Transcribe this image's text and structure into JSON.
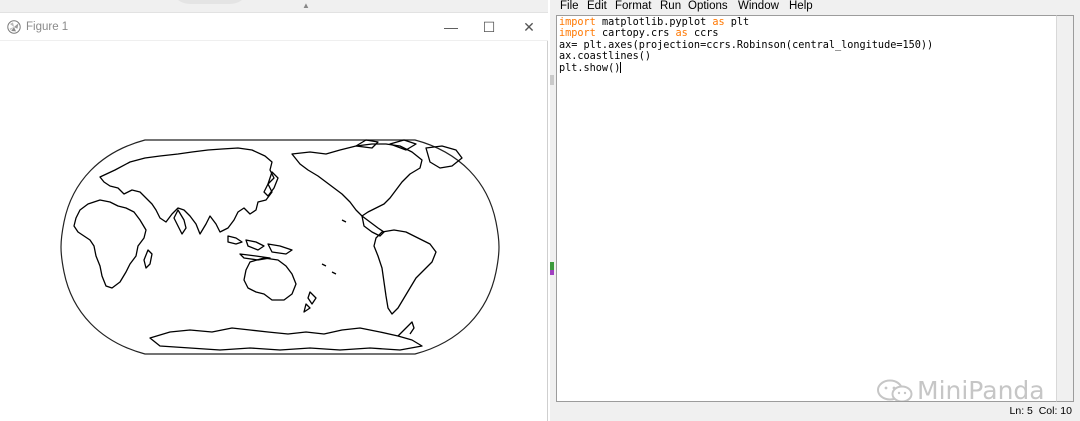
{
  "figure_window": {
    "title": "Figure 1",
    "controls": {
      "minimize": "—",
      "maximize": "☐",
      "close": "✕"
    }
  },
  "editor": {
    "menu": [
      "File",
      "Edit",
      "Format",
      "Run",
      "Options",
      "Window",
      "Help"
    ],
    "code": {
      "line1_kw": "import",
      "line1_rest": " matplotlib.pyplot ",
      "line1_as": "as",
      "line1_end": " plt",
      "line2_kw": "import",
      "line2_rest": " cartopy.crs ",
      "line2_as": "as",
      "line2_end": " ccrs",
      "line3": "ax= plt.axes(projection=ccrs.Robinson(central_longitude=150))",
      "line4": "ax.coastlines()",
      "line5": "plt.show()"
    },
    "watermark": "MiniPanda",
    "status": "Ln: 5  Col: 10"
  },
  "colors": {
    "keyword": "#ff7700",
    "watermark": "#c6c6c6"
  }
}
